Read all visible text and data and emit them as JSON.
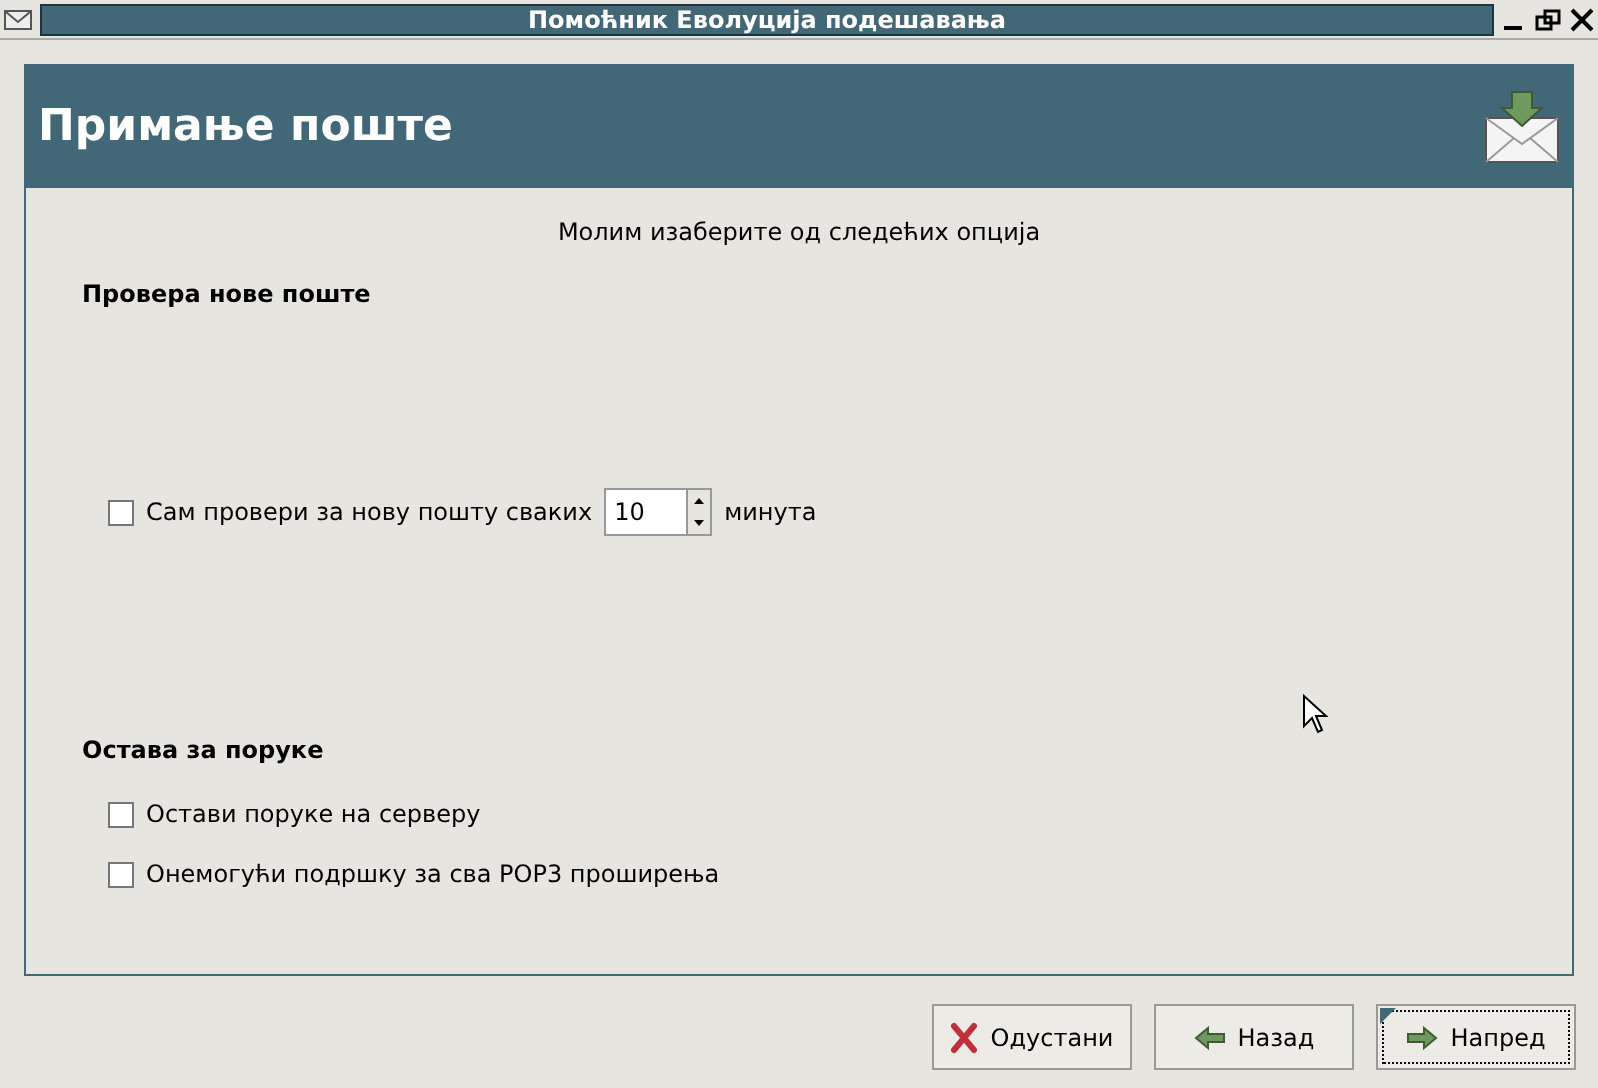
{
  "window": {
    "title": "Помоћник Еволуција подешавања"
  },
  "header": {
    "title": "Примање поште"
  },
  "intro": "Молим изаберите од следећих опција",
  "sections": [
    {
      "title": "Провера нове поште",
      "items": [
        {
          "kind": "spin",
          "label": "Сам провери за нову пошту сваких",
          "checked": false,
          "value": "10",
          "suffix": "минута"
        }
      ]
    },
    {
      "title": "Остава за поруке",
      "items": [
        {
          "kind": "check",
          "label": "Остави поруке на серверу",
          "checked": false
        },
        {
          "kind": "check",
          "label": "Онемогући подршку за сва POP3 проширења",
          "checked": false
        }
      ]
    }
  ],
  "buttons": [
    {
      "kind": "cancel",
      "label": "Одустани",
      "focused": false
    },
    {
      "kind": "back",
      "label": "Назад",
      "focused": false
    },
    {
      "kind": "forward",
      "label": "Напред",
      "focused": true
    }
  ]
}
